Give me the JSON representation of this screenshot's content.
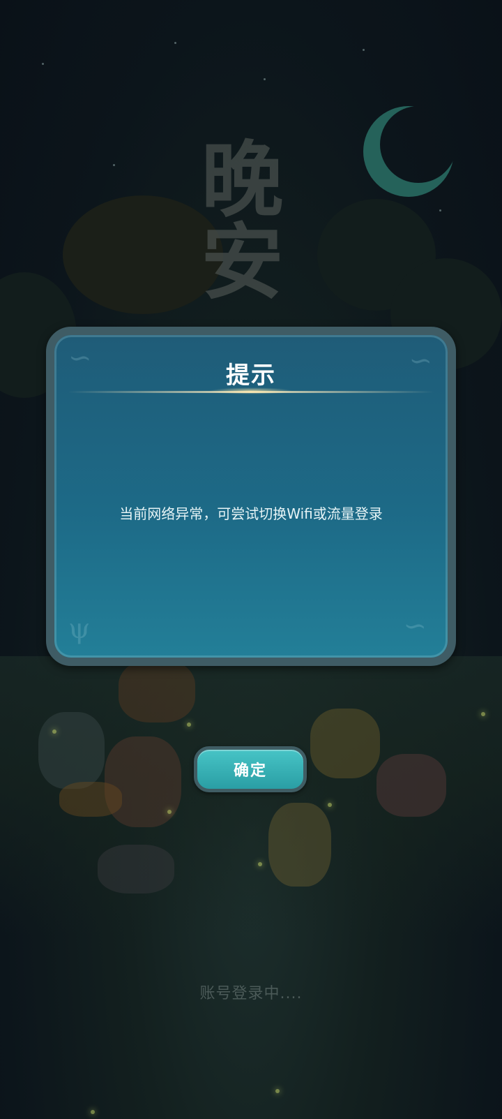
{
  "background": {
    "title_text": "晚安",
    "loading_text": "账号登录中...."
  },
  "dialog": {
    "title": "提示",
    "message": "当前网络异常，可尝试切换Wifi或流量登录",
    "confirm_label": "确定"
  },
  "colors": {
    "dialog_bg": "#1d6a87",
    "dialog_border": "#3f5c65",
    "button": "#38b5b8"
  }
}
